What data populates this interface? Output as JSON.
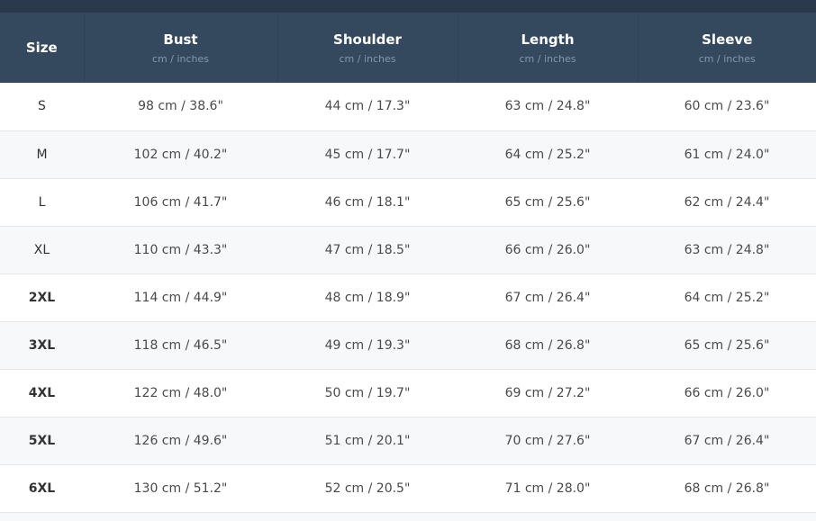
{
  "table": {
    "columns": [
      {
        "title": "Size",
        "unit": ""
      },
      {
        "title": "Bust",
        "unit": "cm / inches"
      },
      {
        "title": "Shoulder",
        "unit": "cm / inches"
      },
      {
        "title": "Length",
        "unit": "cm / inches"
      },
      {
        "title": "Sleeve",
        "unit": "cm / inches"
      }
    ],
    "rows": [
      {
        "size": "S",
        "bust": "98 cm / 38.6\"",
        "shoulder": "44 cm / 17.3\"",
        "length": "63 cm / 24.8\"",
        "sleeve": "60 cm / 23.6\""
      },
      {
        "size": "M",
        "bust": "102 cm / 40.2\"",
        "shoulder": "45 cm / 17.7\"",
        "length": "64 cm / 25.2\"",
        "sleeve": "61 cm / 24.0\""
      },
      {
        "size": "L",
        "bust": "106 cm / 41.7\"",
        "shoulder": "46 cm / 18.1\"",
        "length": "65 cm / 25.6\"",
        "sleeve": "62 cm / 24.4\""
      },
      {
        "size": "XL",
        "bust": "110 cm / 43.3\"",
        "shoulder": "47 cm / 18.5\"",
        "length": "66 cm / 26.0\"",
        "sleeve": "63 cm / 24.8\""
      },
      {
        "size": "2XL",
        "bust": "114 cm / 44.9\"",
        "shoulder": "48 cm / 18.9\"",
        "length": "67 cm / 26.4\"",
        "sleeve": "64 cm / 25.2\""
      },
      {
        "size": "3XL",
        "bust": "118 cm / 46.5\"",
        "shoulder": "49 cm / 19.3\"",
        "length": "68 cm / 26.8\"",
        "sleeve": "65 cm / 25.6\""
      },
      {
        "size": "4XL",
        "bust": "122 cm / 48.0\"",
        "shoulder": "50 cm / 19.7\"",
        "length": "69 cm / 27.2\"",
        "sleeve": "66 cm / 26.0\""
      },
      {
        "size": "5XL",
        "bust": "126 cm / 49.6\"",
        "shoulder": "51 cm / 20.1\"",
        "length": "70 cm / 27.6\"",
        "sleeve": "67 cm / 26.4\""
      },
      {
        "size": "6XL",
        "bust": "130 cm / 51.2\"",
        "shoulder": "52 cm / 20.5\"",
        "length": "71 cm / 28.0\"",
        "sleeve": "68 cm / 26.8\""
      }
    ]
  },
  "colors": {
    "header_bg": "#34495e",
    "header_text": "#ffffff",
    "header_unit_text": "#8598aa",
    "row_alt_bg": "#f6f8fa",
    "cell_text": "#4a4a4a"
  }
}
